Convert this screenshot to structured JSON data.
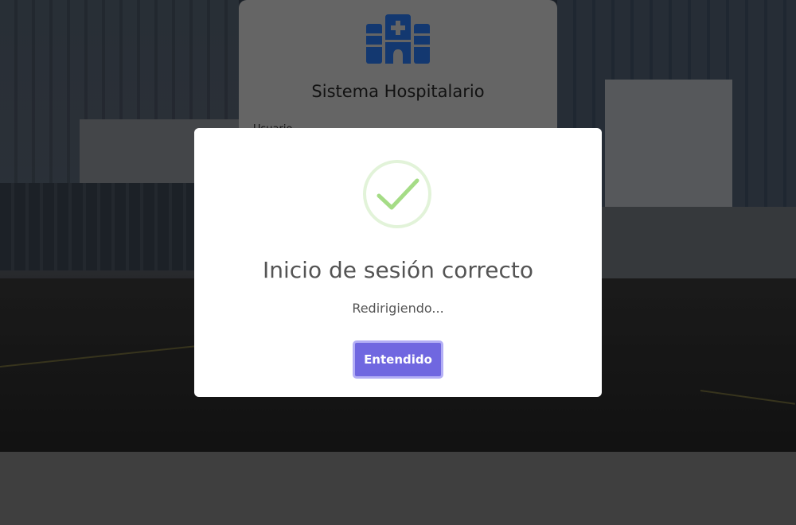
{
  "login": {
    "title": "Sistema Hospitalario",
    "first_field_label": "Usuario"
  },
  "modal": {
    "title": "Inicio de sesión correcto",
    "text": "Redirigiendo...",
    "confirm_label": "Entendido"
  },
  "colors": {
    "icon_blue": "#1f5bb5",
    "success_ring": "#e2f3d9",
    "success_check": "#a5dc86",
    "button_bg": "#7067e0",
    "button_focus_ring": "#b3aef5"
  }
}
